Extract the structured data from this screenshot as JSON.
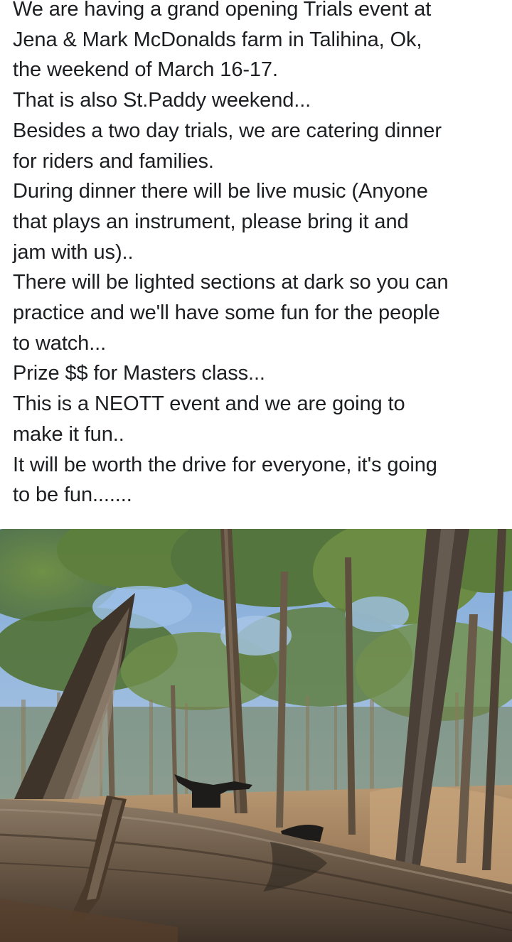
{
  "post": {
    "lines": [
      "We are having a grand opening Trials event at",
      "Jena & Mark McDonalds farm in Talihina, Ok,",
      "the weekend of March 16-17.",
      "That is also St.Paddy weekend...",
      "Besides a two day trials, we are catering dinner",
      "for riders and families.",
      "During dinner there will be live music (Anyone",
      "that plays an instrument, please bring it and",
      "jam with us)..",
      "There will be lighted sections at dark so you can",
      "practice and we'll have some fun for the people",
      "to watch...",
      "Prize $$ for Masters class...",
      "This is a NEOTT event and we are going to",
      "make it fun..",
      "It will be worth the drive for everyone, it's going",
      "to be fun......."
    ]
  },
  "colors": {
    "text": "#1c1e21",
    "background": "#ffffff",
    "sky": "#8cb6e2",
    "foliage": "#5b7a3a",
    "log": "#6b5a48"
  }
}
